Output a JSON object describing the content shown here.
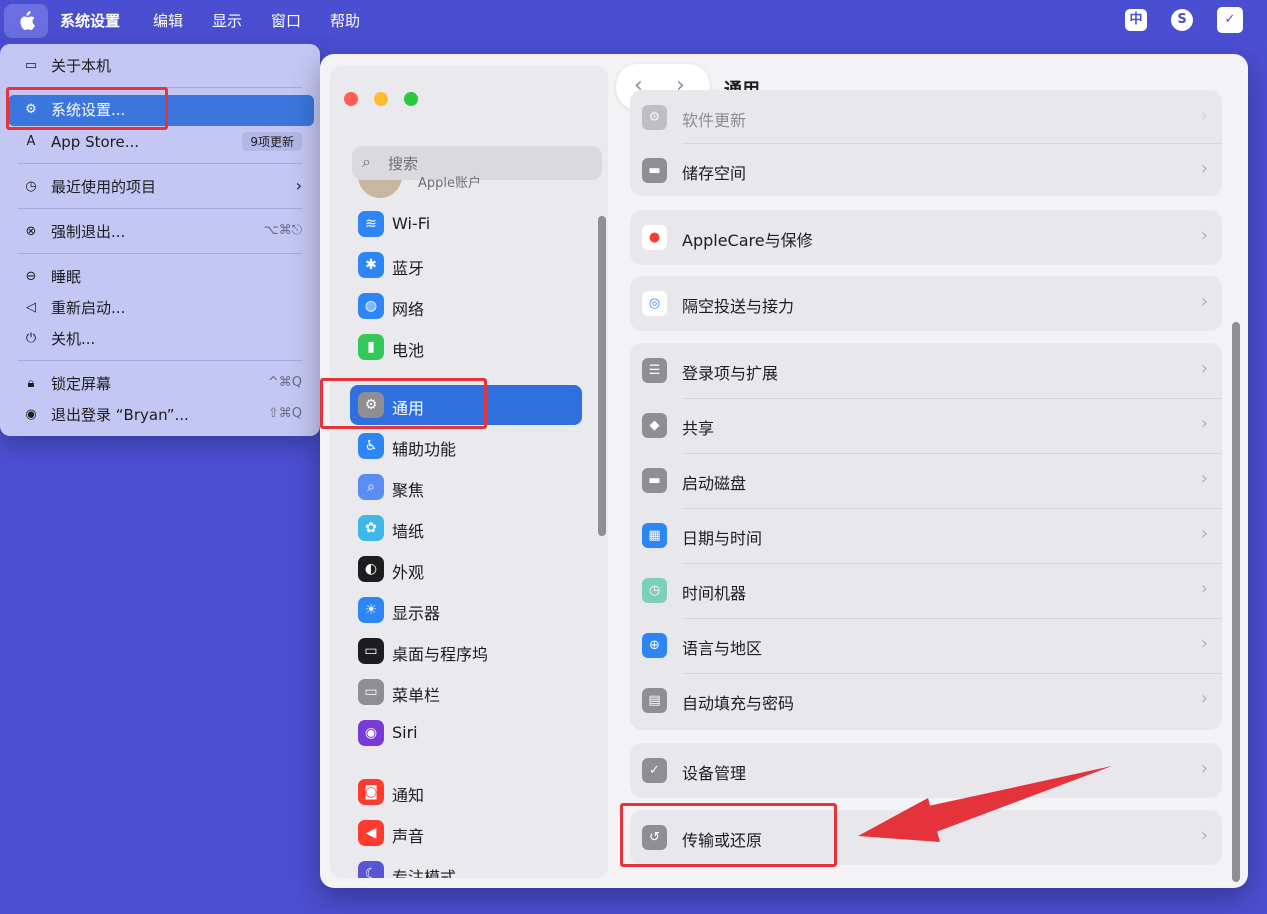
{
  "menubar": {
    "app_name": "系统设置",
    "items": [
      "编辑",
      "显示",
      "窗口",
      "帮助"
    ],
    "status_icons": [
      "中",
      "S",
      "✓"
    ]
  },
  "apple_menu": {
    "about": "关于本机",
    "system_settings": "系统设置...",
    "app_store": "App Store...",
    "app_store_badge": "9项更新",
    "recent_items": "最近使用的项目",
    "force_quit": "强制退出...",
    "force_quit_shortcut": "⌥⌘⎋",
    "sleep": "睡眠",
    "restart": "重新启动...",
    "shutdown": "关机...",
    "lock_screen": "锁定屏幕",
    "lock_shortcut": "^⌘Q",
    "logout": "退出登录 “Bryan”...",
    "logout_shortcut": "⇧⌘Q"
  },
  "sidebar": {
    "search_placeholder": "搜索",
    "account_sub": "Apple账户",
    "items": [
      {
        "label": "Wi-Fi",
        "color": "#2e86f5"
      },
      {
        "label": "蓝牙",
        "color": "#2e86f5"
      },
      {
        "label": "网络",
        "color": "#2e86f5"
      },
      {
        "label": "电池",
        "color": "#34c759"
      },
      {
        "label": "通用",
        "color": "#8e8e93"
      },
      {
        "label": "辅助功能",
        "color": "#2e86f5"
      },
      {
        "label": "聚焦",
        "color": "#5a8ef0"
      },
      {
        "label": "墙纸",
        "color": "#3fb8e8"
      },
      {
        "label": "外观",
        "color": "#1d1d1f"
      },
      {
        "label": "显示器",
        "color": "#2e86f5"
      },
      {
        "label": "桌面与程序坞",
        "color": "#1d1d1f"
      },
      {
        "label": "菜单栏",
        "color": "#8e8e93"
      },
      {
        "label": "Siri",
        "color": "#7a3ad8"
      },
      {
        "label": "通知",
        "color": "#ff3b30"
      },
      {
        "label": "声音",
        "color": "#ff3b30"
      },
      {
        "label": "专注模式",
        "color": "#5856d6"
      }
    ]
  },
  "content": {
    "title": "通用",
    "back": "‹",
    "forward": "›",
    "software_update": "软件更新",
    "storage": "储存空间",
    "applecare": "AppleCare与保修",
    "airdrop": "隔空投送与接力",
    "login_items": "登录项与扩展",
    "sharing": "共享",
    "startup_disk": "启动磁盘",
    "date_time": "日期与时间",
    "time_machine": "时间机器",
    "language_region": "语言与地区",
    "autofill": "自动填充与密码",
    "device_management": "设备管理",
    "transfer_reset": "传输或还原",
    "chevron": "›"
  },
  "colors": {
    "desktop": "#4b4fd2",
    "highlight_red": "#e5333c",
    "selection_blue": "#2f6fde"
  }
}
